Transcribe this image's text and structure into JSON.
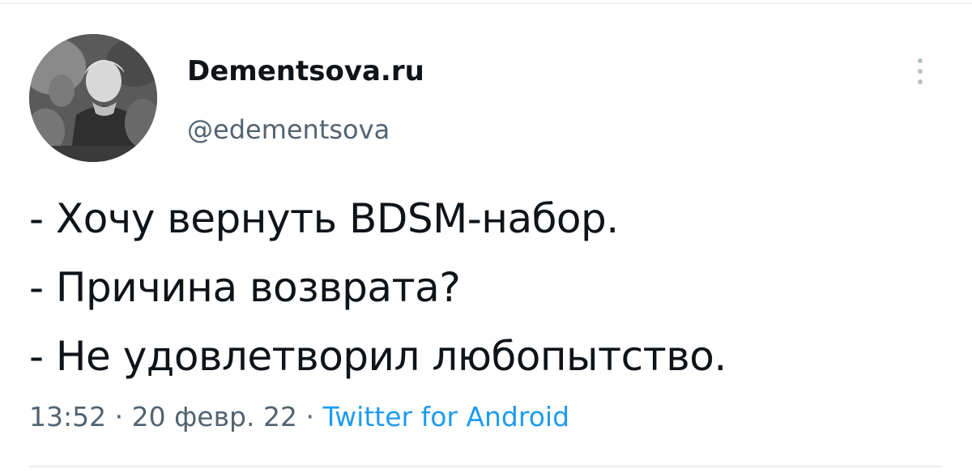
{
  "author": {
    "display_name": "Dementsova.ru",
    "handle": "@edementsova"
  },
  "tweet": {
    "lines": [
      "- Хочу вернуть BDSM-набор.",
      "- Причина возврата?",
      "- Не удовлетворил любопытство."
    ],
    "time": "13:52",
    "separator": "·",
    "date": "20 февр. 22",
    "source": "Twitter for Android"
  },
  "icons": {
    "more": "more-vertical-icon"
  },
  "colors": {
    "text": "#0f1419",
    "secondary": "#536471",
    "link": "#1d9bf0"
  }
}
